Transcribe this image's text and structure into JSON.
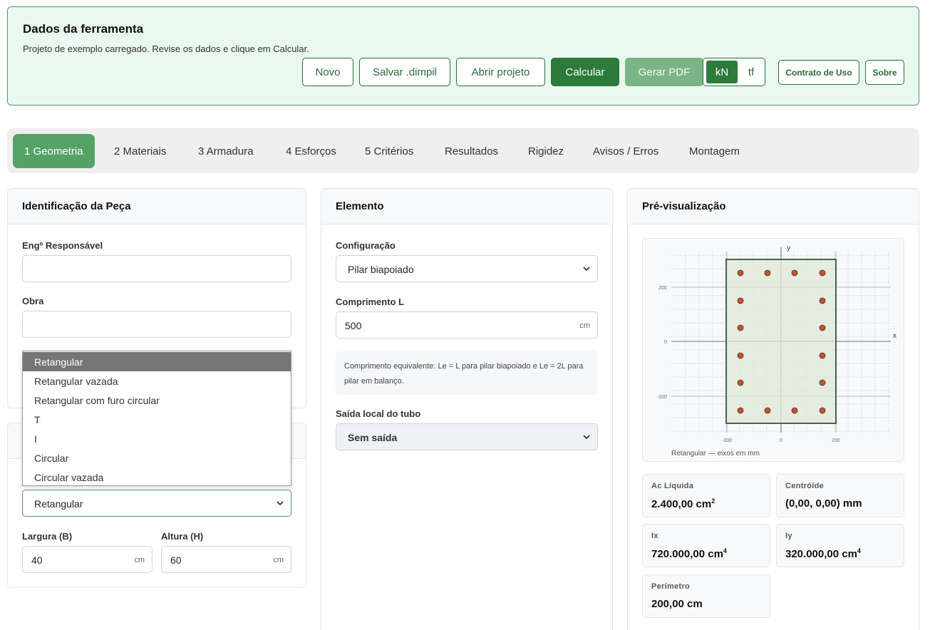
{
  "header": {
    "title": "Dados da ferramenta",
    "subtitle": "Projeto de exemplo carregado. Revise os dados e clique em Calcular.",
    "buttons": {
      "novo": "Novo",
      "salvar": "Salvar .dimpil",
      "abrir": "Abrir projeto",
      "calcular": "Calcular",
      "pdf": "Gerar PDF",
      "contrato": "Contrato de Uso",
      "sobre": "Sobre"
    },
    "units": {
      "kn": "kN",
      "tf": "tf",
      "selected": "kN"
    }
  },
  "tabs": [
    {
      "label": "1 Geometria",
      "active": true
    },
    {
      "label": "2 Materiais"
    },
    {
      "label": "3 Armadura"
    },
    {
      "label": "4 Esforços"
    },
    {
      "label": "5 Critérios"
    },
    {
      "label": "Resultados"
    },
    {
      "label": "Rigidez"
    },
    {
      "label": "Avisos / Erros"
    },
    {
      "label": "Montagem"
    }
  ],
  "identificacao": {
    "title": "Identificação da Peça",
    "eng_label": "Engº Responsável",
    "eng_value": "",
    "obra_label": "Obra",
    "obra_value": ""
  },
  "secao": {
    "dropdown_options": [
      "Retangular",
      "Retangular vazada",
      "Retangular com furo circular",
      "T",
      "I",
      "Circular",
      "Circular vazada"
    ],
    "highlighted": "Retangular",
    "selected": "Retangular",
    "largura_label": "Largura (B)",
    "largura_value": "40",
    "altura_label": "Altura (H)",
    "altura_value": "60",
    "unit": "cm"
  },
  "elemento": {
    "title": "Elemento",
    "config_label": "Configuração",
    "config_value": "Pilar biapoiado",
    "comprimento_label": "Comprimento L",
    "comprimento_value": "500",
    "comprimento_unit": "cm",
    "info": "Comprimento equivalente: Le = L para pilar biapoiado e Le = 2L para pilar em balanço.",
    "saida_label": "Saída local do tubo",
    "saida_value": "Sem saída"
  },
  "preview": {
    "title": "Pré-visualização",
    "axis_x": "x",
    "axis_y": "y",
    "ticks_y": [
      "200",
      "0",
      "-200"
    ],
    "ticks_x": [
      "-200",
      "0",
      "200"
    ],
    "caption": "Retangular — eixos em mm",
    "section_color": "#dfe8d8",
    "section_stroke": "#3d6b45",
    "bar_color": "#c0552d"
  },
  "stats": {
    "ac_label": "Ac Líquida",
    "ac_value": "2.400,00 cm",
    "ac_exp": "2",
    "centroide_label": "Centróide",
    "centroide_value": "(0,00, 0,00) mm",
    "ix_label": "Ix",
    "ix_value": "720.000,00 cm",
    "ix_exp": "4",
    "iy_label": "Iy",
    "iy_value": "320.000,00 cm",
    "iy_exp": "4",
    "perimetro_label": "Perímetro",
    "perimetro_value": "200,00 cm"
  }
}
